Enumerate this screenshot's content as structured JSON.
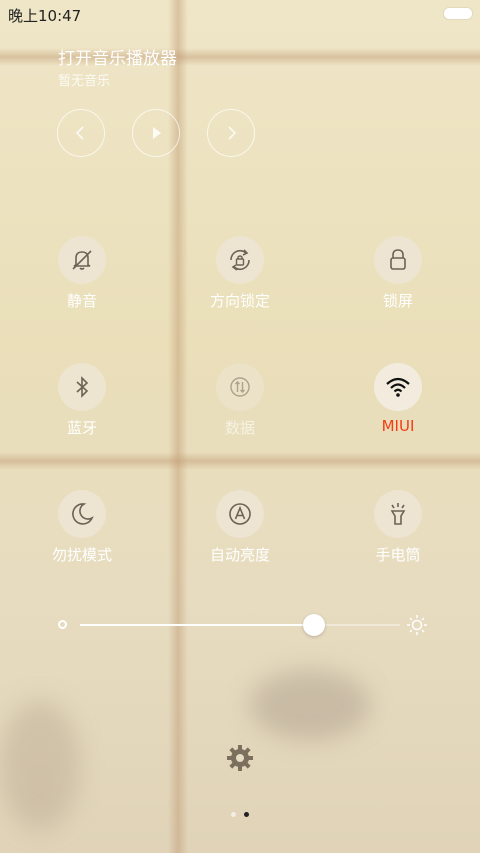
{
  "status_bar": {
    "time": "晚上10:47"
  },
  "music": {
    "title": "打开音乐播放器",
    "subtitle": "暂无音乐"
  },
  "tiles": [
    {
      "label": "静音",
      "icon": "bell-off-icon"
    },
    {
      "label": "方向锁定",
      "icon": "rotation-lock-icon"
    },
    {
      "label": "锁屏",
      "icon": "lock-icon"
    },
    {
      "label": "蓝牙",
      "icon": "bluetooth-icon"
    },
    {
      "label": "数据",
      "icon": "data-transfer-icon"
    },
    {
      "label": "MIUI",
      "icon": "wifi-icon",
      "state": "active"
    },
    {
      "label": "勿扰模式",
      "icon": "moon-icon"
    },
    {
      "label": "自动亮度",
      "icon": "auto-brightness-icon"
    },
    {
      "label": "手电筒",
      "icon": "flashlight-icon"
    }
  ],
  "brightness": {
    "level_percent": 73
  },
  "pager": {
    "pages": 2,
    "current": 2
  },
  "colors": {
    "active_label": "#f43c14",
    "icon": "#6b6355"
  }
}
